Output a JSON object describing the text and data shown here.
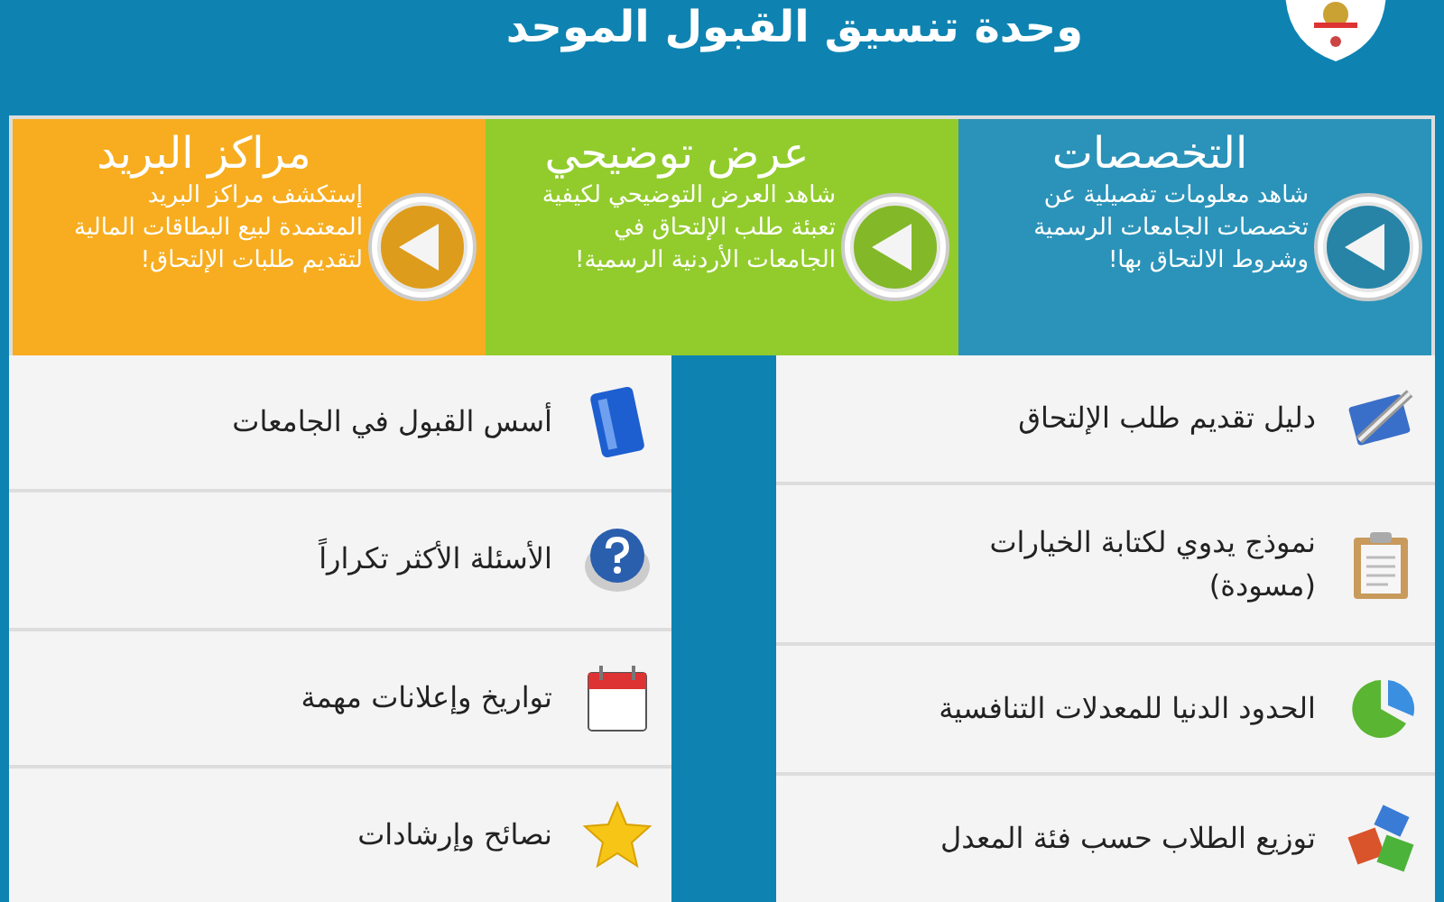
{
  "header": {
    "title": "وحدة تنسيق القبول الموحد"
  },
  "feature_panels": [
    {
      "title": "التخصصات",
      "description": "شاهد معلومات تفصيلية عن تخصصات الجامعات الرسمية وشروط الالتحاق بها!",
      "color": "#2b93b9"
    },
    {
      "title": "عرض توضيحي",
      "description": "شاهد العرض التوضيحي لكيفية تعبئة طلب الإلتحاق في الجامعات الأردنية الرسمية!",
      "color": "#92cc2c"
    },
    {
      "title": "مراكز البريد",
      "description": "إستكشف مراكز البريد المعتمدة لبيع البطاقات المالية لتقديم طلبات الإلتحاق!",
      "color": "#f7ad1f"
    }
  ],
  "right_links": [
    {
      "label": "دليل تقديم طلب الإلتحاق",
      "kind": "guide"
    },
    {
      "label": "نموذج يدوي لكتابة الخيارات (مسودة)",
      "kind": "clipboard"
    },
    {
      "label": "الحدود الدنيا للمعدلات التنافسية",
      "kind": "pie"
    },
    {
      "label": "توزيع الطلاب حسب فئة المعدل",
      "kind": "blocks"
    }
  ],
  "left_links": [
    {
      "label": "أسس القبول في الجامعات",
      "kind": "book"
    },
    {
      "label": "الأسئلة الأكثر تكراراً",
      "kind": "help"
    },
    {
      "label": "تواريخ وإعلانات مهمة",
      "kind": "calendar"
    },
    {
      "label": "نصائح وإرشادات",
      "kind": "star"
    }
  ]
}
